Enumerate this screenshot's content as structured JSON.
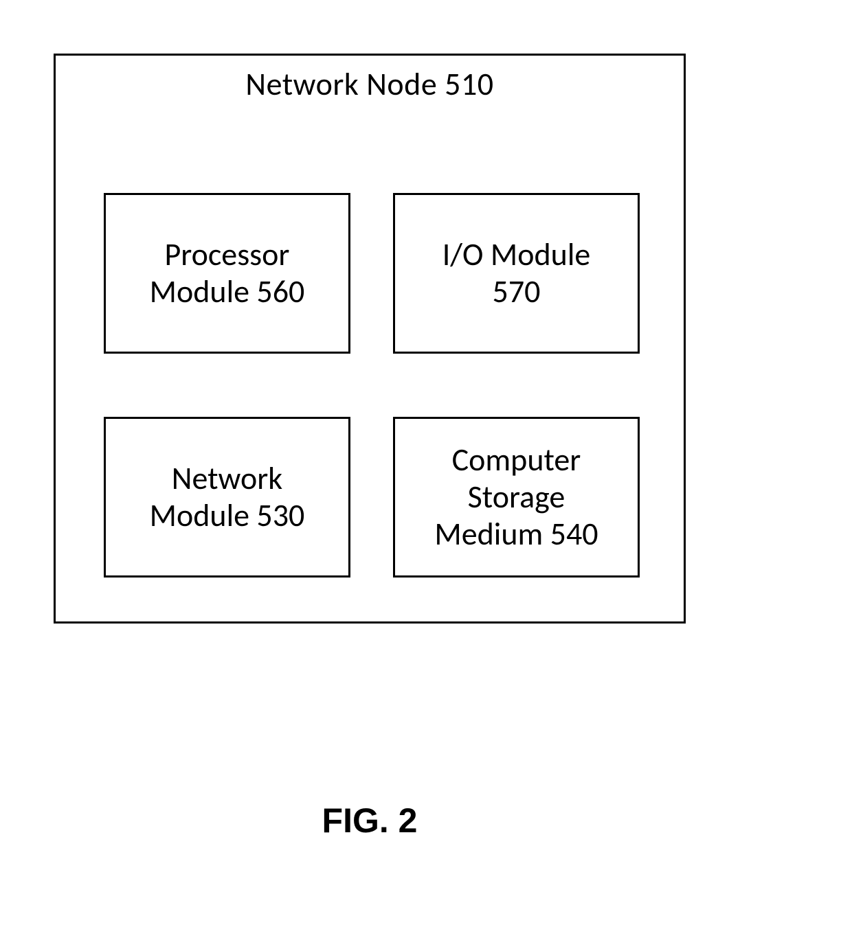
{
  "outer": {
    "title": "Network Node 510"
  },
  "boxes": {
    "top_left": "Processor\nModule 560",
    "top_right": "I/O Module\n570",
    "bottom_left": "Network\nModule 530",
    "bottom_right": "Computer\nStorage\nMedium 540"
  },
  "caption": "FIG. 2"
}
